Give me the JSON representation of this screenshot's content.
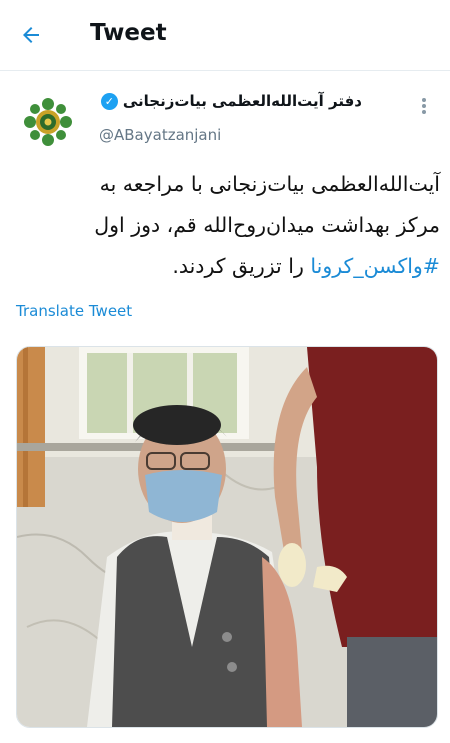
{
  "header": {
    "title": "Tweet"
  },
  "author": {
    "display_name": "دفتر آیت‌الله‌العظمی بیات‌زنجانی",
    "handle": "@ABayatzanjani",
    "verified": true
  },
  "tweet": {
    "line1": "آیت‌الله‌العظمی بیات‌زنجانی با مراجعه به",
    "line2": "مرکز بهداشت میدان‌روح‌الله قم، دوز اول",
    "line3_hashtag": "#واکسن_کرونا",
    "line3_rest": "را تزریق کردند.",
    "translate_label": "Translate Tweet"
  },
  "colors": {
    "accent": "#1b8bd6",
    "verified": "#1da1f2",
    "muted": "#657786"
  },
  "icons": {
    "back": "arrow-left-icon",
    "more": "more-vertical-icon",
    "verified": "verified-badge-icon"
  }
}
